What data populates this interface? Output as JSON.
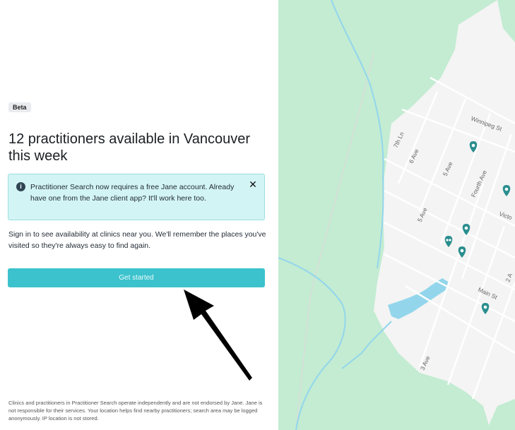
{
  "panel": {
    "badge": "Beta",
    "heading": "12 practitioners available in Vancouver this week",
    "notice": "Practitioner Search now requires a free Jane account. Already have one from the Jane client app? It'll work here too.",
    "notice_icon": "info-icon",
    "close_icon": "close-icon",
    "description": "Sign in to see availability at clinics near you. We'll remember the places you've visited so they're always easy to find again.",
    "cta_label": "Get started",
    "footer": "Clinics and practitioners in Practitioner Search operate independently and are not endorsed by Jane. Jane is not responsible for their services. Your location helps find nearby practitioners; search area may be logged anonymously. IP location is not stored."
  },
  "map": {
    "streets": {
      "winnipeg": "Winnipeg St",
      "seventh_ln": "7th Ln",
      "sixth_ave": "6 Ave",
      "fifth_ave_a": "5 Ave",
      "fourth_ave": "Fourth Ave",
      "fifth_ave_b": "5 Ave",
      "victoria": "Victo",
      "main": "Main St",
      "third_ave": "3 Ave",
      "second": "2 A"
    },
    "pin_icon": "practitioner-pin-icon",
    "group_pin_icon": "group-pin-icon",
    "colors": {
      "park": "#c3ecd2",
      "water": "#93d6ec",
      "land": "#f4f4f4",
      "pin": "#2a8e8e"
    }
  },
  "colors": {
    "accent": "#3cc2cc",
    "notice_bg": "#d3f4f4"
  }
}
